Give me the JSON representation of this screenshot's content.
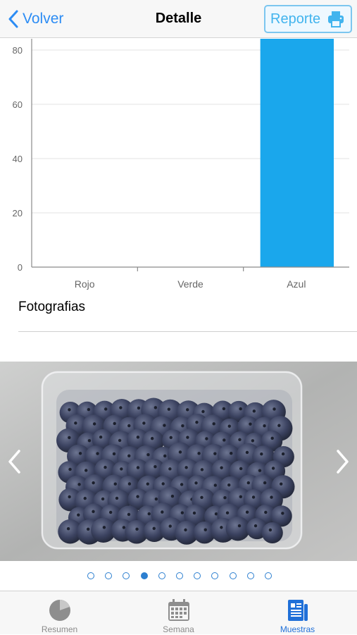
{
  "nav": {
    "back_label": "Volver",
    "title": "Detalle",
    "report_label": "Reporte"
  },
  "chart_data": {
    "type": "bar",
    "categories": [
      "Rojo",
      "Verde",
      "Azul"
    ],
    "values": [
      0,
      0,
      85
    ],
    "ylim": [
      0,
      80
    ],
    "yticks": [
      0,
      20,
      40,
      60,
      80
    ],
    "bar_color": "#1aa7ec",
    "grid": true
  },
  "photos": {
    "section_title": "Fotografias",
    "count": 11,
    "current_index": 3
  },
  "tabs": [
    {
      "label": "Resumen",
      "icon": "pie-chart-icon",
      "active": false
    },
    {
      "label": "Semana",
      "icon": "calendar-icon",
      "active": false
    },
    {
      "label": "Muestras",
      "icon": "document-icon",
      "active": true
    }
  ],
  "colors": {
    "accent": "#2c8cf4",
    "active_tab": "#2070d8",
    "bar": "#1aa7ec"
  }
}
